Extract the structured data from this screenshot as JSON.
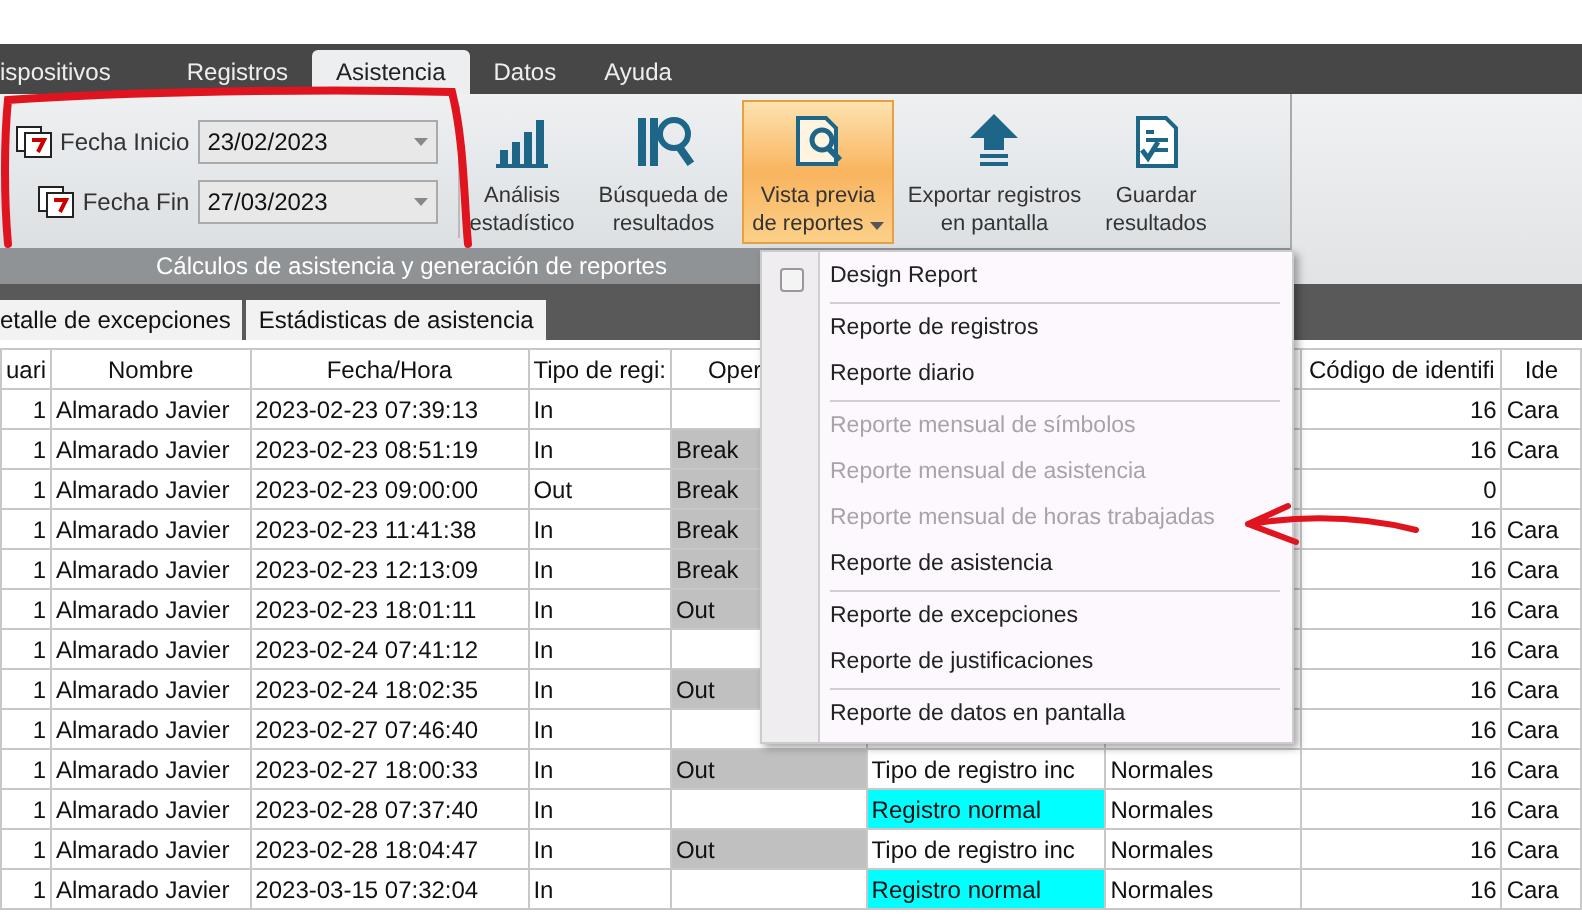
{
  "menu_tabs": [
    {
      "label": "ispositivos",
      "selected": false
    },
    {
      "label": "Registros",
      "selected": false
    },
    {
      "label": "Asistencia",
      "selected": true
    },
    {
      "label": "Datos",
      "selected": false
    },
    {
      "label": "Ayuda",
      "selected": false
    }
  ],
  "date_fields": [
    {
      "label": "Fecha Inicio",
      "value": "23/02/2023"
    },
    {
      "label": "Fecha Fin",
      "value": "27/03/2023"
    }
  ],
  "ribbon_buttons": [
    {
      "kind": "chart",
      "label": "Análisis\nestadístico",
      "selected": false,
      "dropdown": false
    },
    {
      "kind": "search",
      "label": "Búsqueda de\nresultados",
      "selected": false,
      "dropdown": false
    },
    {
      "kind": "preview",
      "label": "Vista previa\nde reportes",
      "selected": true,
      "dropdown": true
    },
    {
      "kind": "export",
      "label": "Exportar registros\nen pantalla",
      "selected": false,
      "dropdown": false
    },
    {
      "kind": "save",
      "label": "Guardar\nresultados",
      "selected": false,
      "dropdown": false
    }
  ],
  "ribbon_group_label": "Cálculos de asistencia y generación de reportes",
  "sub_tabs": [
    {
      "label": "etalle de excepciones"
    },
    {
      "label": "Estádisticas de asistencia"
    }
  ],
  "table": {
    "columns": [
      "uari",
      "Nombre",
      "Fecha/Hora",
      "Tipo de regi:",
      "Oper",
      "",
      "",
      "Código de identifi",
      "Ide"
    ],
    "rows": [
      {
        "user": "1",
        "name": "Almarado Javier",
        "datetime": "2023-02-23 07:39:13",
        "type": "In",
        "oper": "",
        "shaded": false,
        "code": "16",
        "ident": "Cara"
      },
      {
        "user": "1",
        "name": "Almarado Javier",
        "datetime": "2023-02-23 08:51:19",
        "type": "In",
        "oper": "Break",
        "shaded": true,
        "code": "16",
        "ident": "Cara"
      },
      {
        "user": "1",
        "name": "Almarado Javier",
        "datetime": "2023-02-23 09:00:00",
        "type": "Out",
        "oper": "Break",
        "shaded": true,
        "code": "0",
        "ident": ""
      },
      {
        "user": "1",
        "name": "Almarado Javier",
        "datetime": "2023-02-23 11:41:38",
        "type": "In",
        "oper": "Break",
        "shaded": true,
        "code": "16",
        "ident": "Cara"
      },
      {
        "user": "1",
        "name": "Almarado Javier",
        "datetime": "2023-02-23 12:13:09",
        "type": "In",
        "oper": "Break",
        "shaded": true,
        "code": "16",
        "ident": "Cara"
      },
      {
        "user": "1",
        "name": "Almarado Javier",
        "datetime": "2023-02-23 18:01:11",
        "type": "In",
        "oper": "Out",
        "shaded": true,
        "code": "16",
        "ident": "Cara"
      },
      {
        "user": "1",
        "name": "Almarado Javier",
        "datetime": "2023-02-24 07:41:12",
        "type": "In",
        "oper": "",
        "shaded": false,
        "code": "16",
        "ident": "Cara"
      },
      {
        "user": "1",
        "name": "Almarado Javier",
        "datetime": "2023-02-24 18:02:35",
        "type": "In",
        "oper": "Out",
        "shaded": true,
        "code": "16",
        "ident": "Cara"
      },
      {
        "user": "1",
        "name": "Almarado Javier",
        "datetime": "2023-02-27 07:46:40",
        "type": "In",
        "oper": "",
        "shaded": false,
        "code": "16",
        "ident": "Cara"
      },
      {
        "user": "1",
        "name": "Almarado Javier",
        "datetime": "2023-02-27 18:00:33",
        "type": "In",
        "oper": "Out",
        "shaded": true,
        "status": "Tipo de registro inc",
        "highlight": false,
        "class": "Normales",
        "code": "16",
        "ident": "Cara"
      },
      {
        "user": "1",
        "name": "Almarado Javier",
        "datetime": "2023-02-28 07:37:40",
        "type": "In",
        "oper": "",
        "shaded": false,
        "status": "Registro normal",
        "highlight": true,
        "class": "Normales",
        "code": "16",
        "ident": "Cara"
      },
      {
        "user": "1",
        "name": "Almarado Javier",
        "datetime": "2023-02-28 18:04:47",
        "type": "In",
        "oper": "Out",
        "shaded": true,
        "status": "Tipo de registro inc",
        "highlight": false,
        "class": "Normales",
        "code": "16",
        "ident": "Cara"
      },
      {
        "user": "1",
        "name": "Almarado Javier",
        "datetime": "2023-03-15 07:32:04",
        "type": "In",
        "oper": "",
        "shaded": false,
        "status": "Registro normal",
        "highlight": true,
        "class": "Normales",
        "code": "16",
        "ident": "Cara"
      }
    ]
  },
  "dropdown_menu": [
    {
      "kind": "checkbox",
      "label": "Design Report",
      "checked": false
    },
    {
      "kind": "separator"
    },
    {
      "kind": "item",
      "label": "Reporte de registros",
      "disabled": false
    },
    {
      "kind": "item",
      "label": "Reporte diario",
      "disabled": false
    },
    {
      "kind": "separator"
    },
    {
      "kind": "item",
      "label": "Reporte mensual de símbolos",
      "disabled": true
    },
    {
      "kind": "item",
      "label": "Reporte mensual de asistencia",
      "disabled": true
    },
    {
      "kind": "item",
      "label": "Reporte mensual de horas trabajadas",
      "disabled": true
    },
    {
      "kind": "item",
      "label": "Reporte de asistencia",
      "disabled": false
    },
    {
      "kind": "separator"
    },
    {
      "kind": "item",
      "label": "Reporte de excepciones",
      "disabled": false
    },
    {
      "kind": "item",
      "label": "Reporte de justificaciones",
      "disabled": false
    },
    {
      "kind": "separator"
    },
    {
      "kind": "item",
      "label": "Reporte de datos en pantalla",
      "disabled": false
    }
  ]
}
